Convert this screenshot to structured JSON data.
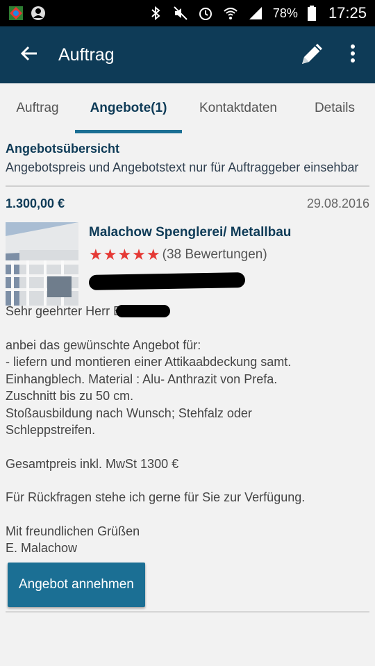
{
  "status_bar": {
    "battery": "78%",
    "time": "17:25"
  },
  "app_bar": {
    "title": "Auftrag",
    "back_icon": "arrow-left-icon",
    "edit_icon": "pencil-icon",
    "menu_icon": "more-vertical-icon"
  },
  "tabs": [
    {
      "label": "Auftrag",
      "active": false
    },
    {
      "label": "Angebote(1)",
      "active": true
    },
    {
      "label": "Kontaktdaten",
      "active": false
    },
    {
      "label": "Details",
      "active": false
    }
  ],
  "overview": {
    "title": "Angebotsübersicht",
    "subtitle": "Angebotspreis und Angebotstext nur für Auftraggeber einsehbar"
  },
  "offer": {
    "price": "1.300,00  €",
    "date": "29.08.2016",
    "company": "Malachow Spenglerei/ Metallbau",
    "stars": "★★★★★",
    "rating": 5,
    "reviews": "(38 Bewertungen)",
    "greeting": "Sehr geehrter Herr B",
    "body_1": "anbei das gewünschte Angebot für:\n- liefern und montieren einer Attikaabdeckung samt.\nEinhangblech. Material : Alu- Anthrazit von Prefa.\nZuschnitt bis zu 50 cm.\nStoßausbildung nach Wunsch; Stehfalz oder\nSchleppstreifen.",
    "body_2": "Gesamtpreis inkl. MwSt 1300 €",
    "body_3": "Für Rückfragen stehe ich gerne für Sie zur Verfügung.",
    "closing": "Mit freundlichen Grüßen\nE. Malachow",
    "accept_label": "Angebot annehmen"
  },
  "colors": {
    "appbar": "#0e3b57",
    "accent": "#1b6f94",
    "star": "#e53935"
  }
}
